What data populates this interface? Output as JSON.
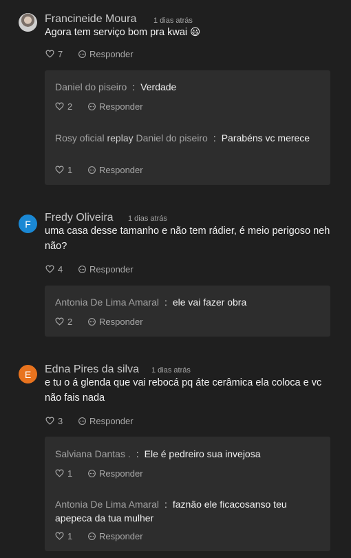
{
  "labels": {
    "reply": "Responder",
    "replay": "replay",
    "colon": ":"
  },
  "comments": [
    {
      "author": "Francineide Moura",
      "time": "1 dias atrás",
      "text": "Agora tem serviço bom pra kwai 😃",
      "likes": "7",
      "replies": [
        {
          "name": "Daniel do piseiro",
          "text": "Verdade",
          "likes": "2"
        },
        {
          "name": "Rosy oficial",
          "replay_to": "Daniel do piseiro",
          "text": "Parabéns vc merece",
          "likes": "1"
        }
      ]
    },
    {
      "author": "Fredy Oliveira",
      "avatar_letter": "F",
      "time": "1 dias atrás",
      "text": "uma casa desse tamanho e não tem rádier, é meio perigoso neh não?",
      "likes": "4",
      "replies": [
        {
          "name": "Antonia De Lima Amaral",
          "text": "ele vai fazer obra",
          "likes": "2"
        }
      ]
    },
    {
      "author": "Edna Pires da silva",
      "avatar_letter": "E",
      "time": "1 dias atrás",
      "text": "e tu o á glenda que vai rebocá pq áte cerâmica ela coloca e vc não fais nada",
      "likes": "3",
      "replies": [
        {
          "name": "Salviana Dantas .",
          "text": "Ele é pedreiro sua invejosa",
          "likes": "1"
        },
        {
          "name": "Antonia De Lima Amaral",
          "text": "faznão ele ficacosanso teu apepeca da tua mulher",
          "likes": "1"
        }
      ]
    }
  ],
  "colors": {
    "background": "#1f1f1f",
    "reply_box": "#2d2d2d",
    "avatar_f": "#1a88d4",
    "avatar_e": "#e8731e"
  }
}
